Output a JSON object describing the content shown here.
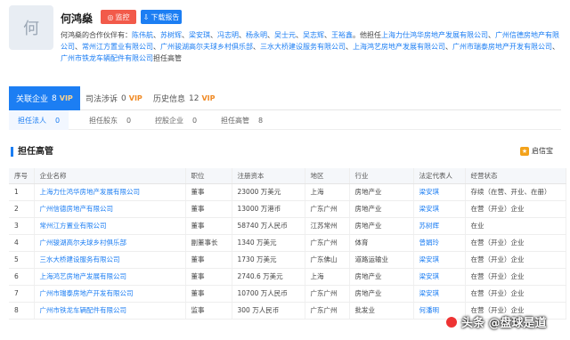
{
  "header": {
    "avatar_char": "何",
    "name": "何鸿燊",
    "monitor_label": "监控",
    "download_label": "下载报告",
    "partners_prefix": "何鸿燊的合作伙伴有：",
    "partners": [
      "陈伟航",
      "苏树辉",
      "梁安琪",
      "冯志明",
      "杨永明",
      "吴士元",
      "吴志辉",
      "王裕鑫"
    ],
    "partners_mid": "。他担任",
    "companies": [
      "上海力仕鸿华房地产发展有限公司",
      "广州信德房地产有限公司",
      "常州江方置业有限公司",
      "广州骏湖高尔夫球乡村俱乐部",
      "三水大桥建设服务有限公司",
      "上海鸿艺房地产发展有限公司",
      "广州市瑞泰房地产开发有限公司",
      "广州市铁龙车辆配件有限公司"
    ],
    "partners_suffix": "担任高管"
  },
  "tabs": [
    {
      "label": "关联企业",
      "count": "8",
      "vip": "VIP",
      "active": true
    },
    {
      "label": "司法涉诉",
      "count": "0",
      "vip": "VIP",
      "active": false
    },
    {
      "label": "历史信息",
      "count": "12",
      "vip": "VIP",
      "active": false
    }
  ],
  "subtabs": [
    {
      "label": "担任法人",
      "count": "0"
    },
    {
      "label": "担任股东",
      "count": "0"
    },
    {
      "label": "控股企业",
      "count": "0"
    },
    {
      "label": "担任高管",
      "count": "8"
    }
  ],
  "section": {
    "title": "担任高管",
    "brand": "启信宝"
  },
  "table": {
    "headers": [
      "序号",
      "企业名称",
      "职位",
      "注册资本",
      "地区",
      "行业",
      "法定代表人",
      "经营状态"
    ],
    "rows": [
      [
        "1",
        "上海力仕鸿华房地产发展有限公司",
        "董事",
        "23000 万美元",
        "上海",
        "房地产业",
        "梁安琪",
        "存续（在营、开业、在册）"
      ],
      [
        "2",
        "广州信德房地产有限公司",
        "董事",
        "13000 万港币",
        "广东广州",
        "房地产业",
        "梁安琪",
        "在营（开业）企业"
      ],
      [
        "3",
        "常州江方置业有限公司",
        "董事",
        "58740 万人民币",
        "江苏常州",
        "房地产业",
        "苏树辉",
        "在业"
      ],
      [
        "4",
        "广州骏湖高尔夫球乡村俱乐部",
        "副董事长",
        "1340 万美元",
        "广东广州",
        "体育",
        "曾娟玲",
        "在营（开业）企业"
      ],
      [
        "5",
        "三水大桥建设服务有限公司",
        "董事",
        "1730 万美元",
        "广东佛山",
        "道路运输业",
        "梁安琪",
        "在营（开业）企业"
      ],
      [
        "6",
        "上海鸿艺房地产发展有限公司",
        "董事",
        "2740.6 万美元",
        "上海",
        "房地产业",
        "梁安琪",
        "在营（开业）企业"
      ],
      [
        "7",
        "广州市瑞泰房地产开发有限公司",
        "董事",
        "10700 万人民币",
        "广东广州",
        "房地产业",
        "梁安琪",
        "在营（开业）企业"
      ],
      [
        "8",
        "广州市铁龙车辆配件有限公司",
        "监事",
        "300 万人民币",
        "广东广州",
        "批发业",
        "何潘明",
        "在营（开业）企业"
      ]
    ]
  },
  "watermark": "头条 @盘球是道"
}
